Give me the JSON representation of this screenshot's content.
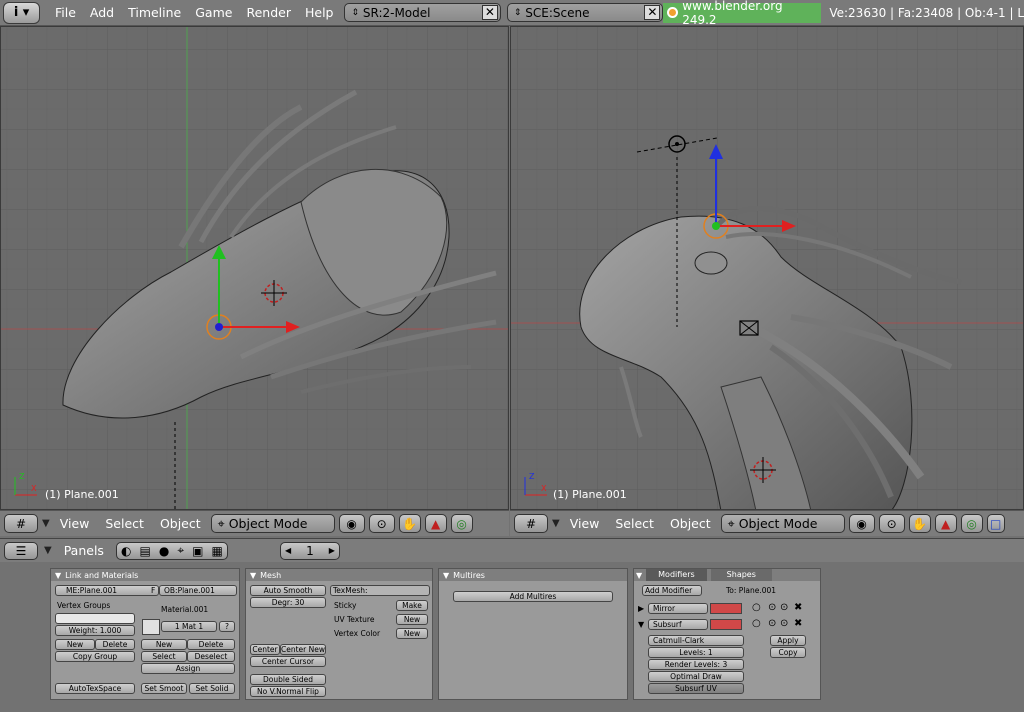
{
  "topbar": {
    "info_icon": "info-icon",
    "menus": [
      "File",
      "Add",
      "Timeline",
      "Game",
      "Render",
      "Help"
    ],
    "screen_field": "SR:2-Model",
    "scene_field": "SCE:Scene",
    "url": "www.blender.org 249.2",
    "stats": "Ve:23630 | Fa:23408 | Ob:4-1 | L"
  },
  "viewport_left": {
    "object_label": "(1) Plane.001",
    "header": {
      "view": "View",
      "select": "Select",
      "object": "Object",
      "mode": "Object Mode"
    }
  },
  "viewport_right": {
    "object_label": "(1) Plane.001",
    "header": {
      "view": "View",
      "select": "Select",
      "object": "Object",
      "mode": "Object Mode"
    }
  },
  "buttons_header": {
    "panels": "Panels",
    "frame": "1"
  },
  "link_materials": {
    "title": "Link and Materials",
    "me_field": "ME:Plane.001",
    "f_label": "F",
    "ob_field": "OB:Plane.001",
    "vertex_groups": "Vertex Groups",
    "material_name": "Material.001",
    "weight": "Weight: 1.000",
    "mat_index": "1 Mat 1",
    "question": "?",
    "new": "New",
    "delete": "Delete",
    "copy_group": "Copy Group",
    "new2": "New",
    "delete2": "Delete",
    "select": "Select",
    "deselect": "Deselect",
    "assign": "Assign",
    "autotexspace": "AutoTexSpace",
    "set_smooth": "Set Smoot",
    "set_solid": "Set Solid"
  },
  "mesh": {
    "title": "Mesh",
    "auto_smooth": "Auto Smooth",
    "degr": "Degr: 30",
    "texmesh": "TexMesh:",
    "sticky": "Sticky",
    "make": "Make",
    "uv_texture": "UV Texture",
    "new_uv": "New",
    "vertex_color": "Vertex Color",
    "new_vc": "New",
    "center": "Center",
    "center_new": "Center New",
    "center_cursor": "Center Cursor",
    "double_sided": "Double Sided",
    "no_vnormal": "No V.Normal Flip"
  },
  "multires": {
    "title": "Multires",
    "add": "Add Multires"
  },
  "modifiers": {
    "tab_modifiers": "Modifiers",
    "tab_shapes": "Shapes",
    "add_modifier": "Add Modifier",
    "to": "To: Plane.001",
    "mirror": "Mirror",
    "subsurf": "Subsurf",
    "catmull": "Catmull-Clark",
    "levels": "Levels: 1",
    "render_levels": "Render Levels: 3",
    "optimal_draw": "Optimal Draw",
    "subsurf_uv": "Subsurf UV",
    "apply": "Apply",
    "copy": "Copy"
  }
}
